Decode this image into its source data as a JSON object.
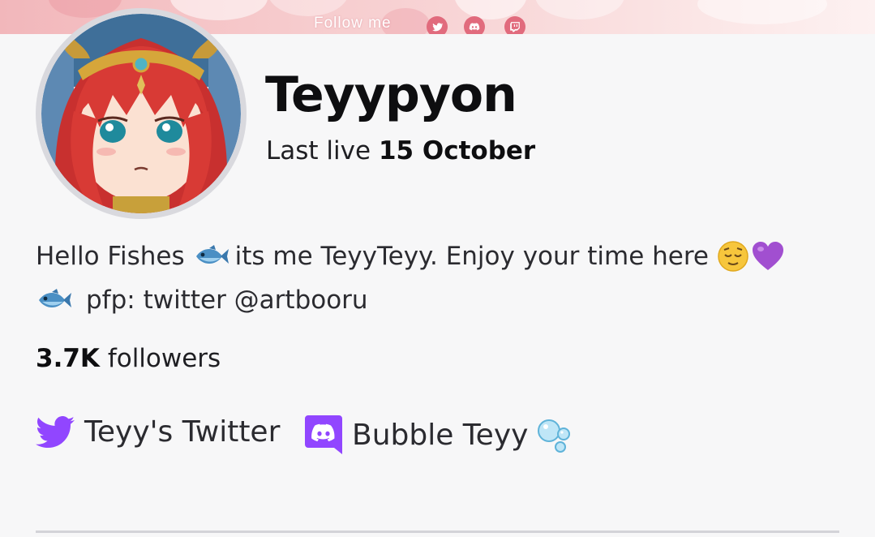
{
  "banner": {
    "follow_label": "Follow me",
    "icons": [
      "twitter-icon",
      "discord-icon",
      "twitch-icon"
    ],
    "accent_color": "#e16b7d"
  },
  "channel": {
    "name": "Teyypyon",
    "last_live_label": "Last live",
    "last_live_date": "15 October"
  },
  "bio": {
    "line1_part1": "Hello Fishes",
    "line1_part2": "its me TeyyTeyy. Enjoy your time here",
    "line2": "pfp: twitter @artbooru",
    "emojis": [
      "fish-emoji",
      "relieved-face-emoji",
      "purple-heart-emoji"
    ]
  },
  "stats": {
    "followers_count": "3.7K",
    "followers_label": "followers"
  },
  "links": [
    {
      "label": "Teyy's Twitter",
      "icon": "twitter-icon"
    },
    {
      "label": "Bubble Teyy",
      "icon": "discord-icon",
      "suffix_icon": "bubbles-emoji"
    }
  ],
  "colors": {
    "link_icon": "#9146ff",
    "text_primary": "#0e0e10",
    "background": "#f7f7f8"
  }
}
